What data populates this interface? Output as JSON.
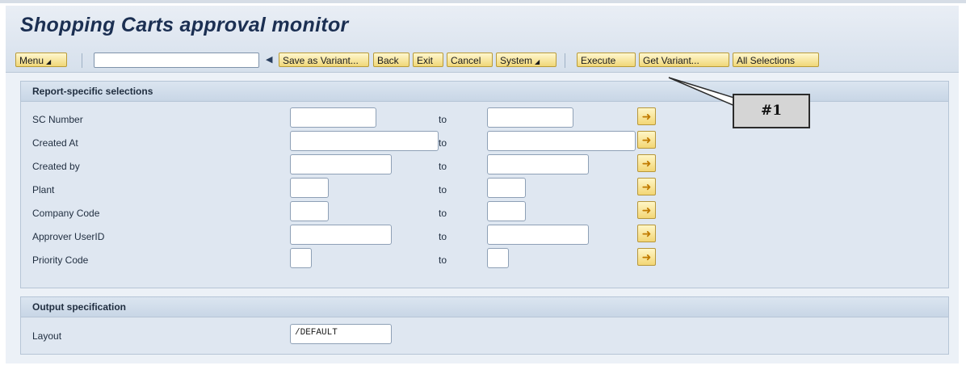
{
  "window": {
    "title": "Shopping Carts approval monitor"
  },
  "toolbar": {
    "menu_label": "Menu",
    "command_field": "",
    "buttons": [
      "Save as Variant...",
      "Back",
      "Exit",
      "Cancel",
      "System"
    ],
    "buttons2": [
      "Execute",
      "Get Variant...",
      "All Selections"
    ]
  },
  "report_selections": {
    "title": "Report-specific selections",
    "to_label": "to",
    "rows": [
      {
        "label": "SC Number",
        "from": "",
        "to": ""
      },
      {
        "label": "Created At",
        "from": "",
        "to": ""
      },
      {
        "label": "Created by",
        "from": "",
        "to": ""
      },
      {
        "label": "Plant",
        "from": "",
        "to": ""
      },
      {
        "label": "Company Code",
        "from": "",
        "to": ""
      },
      {
        "label": "Approver UserID",
        "from": "",
        "to": ""
      },
      {
        "label": "Priority Code",
        "from": "",
        "to": ""
      }
    ]
  },
  "output_spec": {
    "title": "Output specification",
    "layout_label": "Layout",
    "layout_value": "/DEFAULT"
  },
  "callout": {
    "label": "#1"
  },
  "icons": {
    "multiple_selection": "arrow-right-icon",
    "menu_dropdown": "triangle-down-icon",
    "command_back": "triangle-left-icon"
  },
  "colors": {
    "button_fill": "#f0d778",
    "panel_bg": "#dfe7f1",
    "title_text": "#1b2f52"
  }
}
